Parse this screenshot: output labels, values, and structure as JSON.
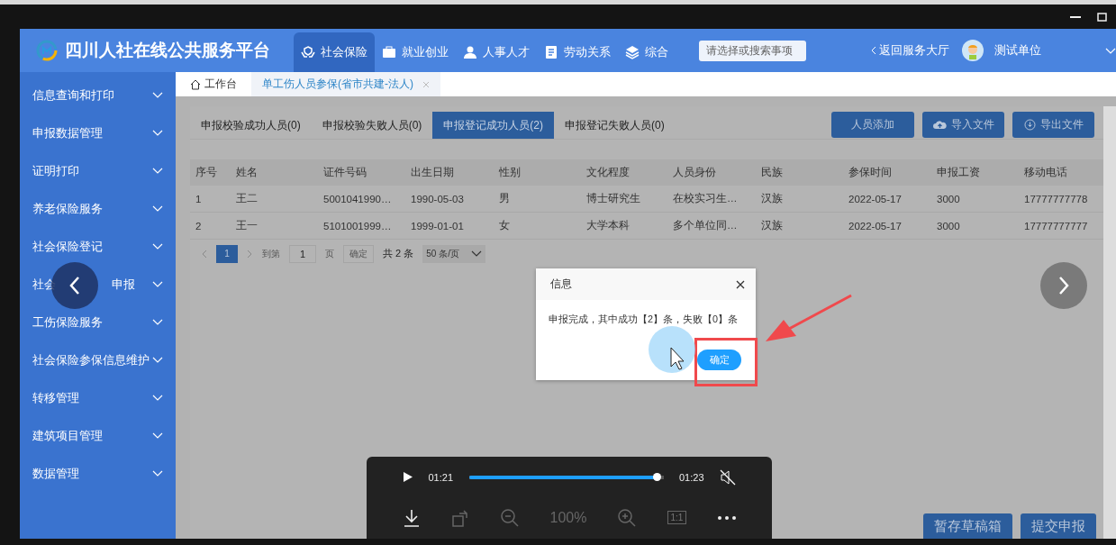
{
  "header": {
    "title": "四川人社在线公共服务平台",
    "nav": [
      {
        "label": "社会保险",
        "selected": true
      },
      {
        "label": "就业创业",
        "selected": false
      },
      {
        "label": "人事人才",
        "selected": false
      },
      {
        "label": "劳动关系",
        "selected": false
      },
      {
        "label": "综合",
        "selected": false
      }
    ],
    "search": {
      "placeholder": "请选择或搜索事项"
    },
    "back_link": "返回服务大厅",
    "user": "测试单位"
  },
  "sidebar": {
    "items": [
      {
        "label": "信息查询和打印"
      },
      {
        "label": "申报数据管理"
      },
      {
        "label": "证明打印"
      },
      {
        "label": "养老保险服务"
      },
      {
        "label": "社会保险登记"
      },
      {
        "label": "社会",
        "label_end": "申报"
      },
      {
        "label": "工伤保险服务"
      },
      {
        "label": "社会保险参保信息维护"
      },
      {
        "label": "转移管理"
      },
      {
        "label": "建筑项目管理"
      },
      {
        "label": "数据管理"
      }
    ]
  },
  "page_tabs": [
    {
      "label": "工作台",
      "kind": "home",
      "selected": false
    },
    {
      "label": "单工伤人员参保(省市共建-法人)",
      "kind": "closable",
      "selected": true
    }
  ],
  "result_tabs": [
    {
      "label": "申报校验成功人员(0)",
      "selected": false
    },
    {
      "label": "申报校验失败人员(0)",
      "selected": false
    },
    {
      "label": "申报登记成功人员(2)",
      "selected": true
    },
    {
      "label": "申报登记失败人员(0)",
      "selected": false
    }
  ],
  "toolbar": [
    "人员添加",
    "导入文件",
    "导出文件"
  ],
  "table": {
    "columns": [
      "序号",
      "姓名",
      "证件号码",
      "出生日期",
      "性别",
      "文化程度",
      "人员身份",
      "民族",
      "参保时间",
      "申报工资",
      "移动电话"
    ],
    "rows": [
      [
        "1",
        "王二",
        "5001041990…",
        "1990-05-03",
        "男",
        "博士研究生",
        "在校实习生…",
        "汉族",
        "2022-05-17",
        "3000",
        "17777777778"
      ],
      [
        "2",
        "王一",
        "5101001999…",
        "1999-01-01",
        "女",
        "大学本科",
        "多个单位同…",
        "汉族",
        "2022-05-17",
        "3000",
        "17777777777"
      ]
    ]
  },
  "pagination": {
    "pages": [
      {
        "label": "1",
        "selected": true
      }
    ],
    "goto_label": "到第",
    "goto_value": "1",
    "page_unit": "页",
    "confirm": "确定",
    "total": "共 2 条",
    "page_size": "50 条/页"
  },
  "footer_buttons": [
    "暂存草稿箱",
    "提交申报"
  ],
  "dialog": {
    "title": "信息",
    "message": "申报完成，其中成功【2】条，失败【0】条",
    "button": "确定"
  },
  "player": {
    "elapsed": "01:21",
    "duration": "01:23",
    "level": 0.99,
    "muted": true,
    "zoom": "100%",
    "actual_size": "1:1"
  }
}
